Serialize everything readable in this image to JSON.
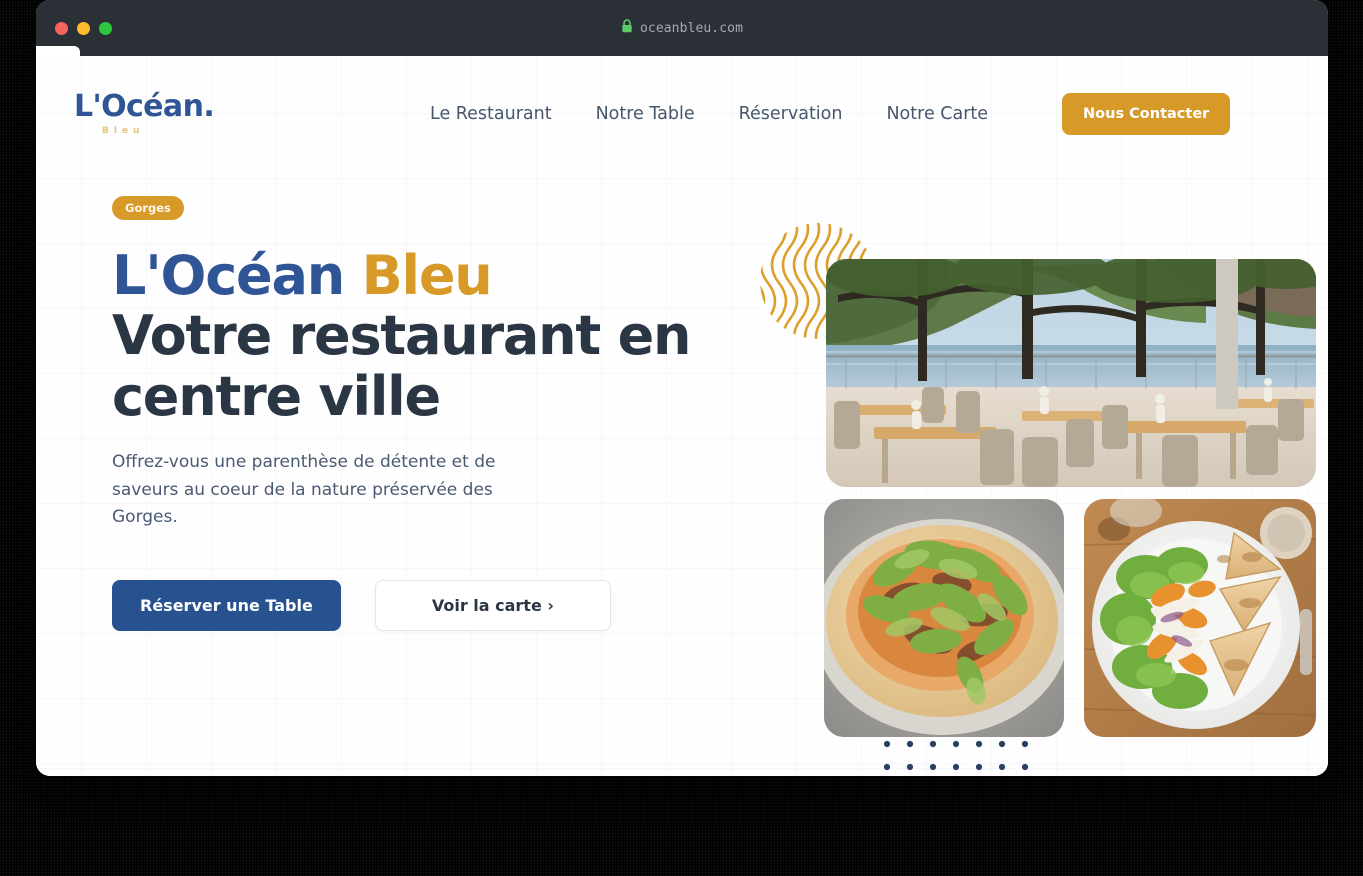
{
  "browser": {
    "traffic_lights": [
      "close-red",
      "minimize-yellow",
      "maximize-green"
    ],
    "lock_icon": "padlock-icon",
    "url": "oceanbleu.com"
  },
  "header": {
    "logo": {
      "main": "L'Océan",
      "dot": ".",
      "sub": "Bleu"
    },
    "nav": [
      {
        "label": "Le Restaurant"
      },
      {
        "label": "Notre Table"
      },
      {
        "label": "Réservation"
      },
      {
        "label": "Notre Carte"
      }
    ],
    "contact_button": "Nous Contacter"
  },
  "hero": {
    "badge": "Gorges",
    "title_line1_blue": "L'Océan ",
    "title_line1_gold": "Bleu",
    "title_line2": "Votre restaurant en",
    "title_line3": "centre ville",
    "subtitle": "Offrez-vous une parenthèse de détente et de saveurs au coeur de la nature préservée des Gorges.",
    "primary_button": "Réserver une Table",
    "secondary_button": "Voir la carte ›",
    "decorations": {
      "waves": "wavy-lines-circle-decoration",
      "dots": "dot-grid-decoration",
      "dot_columns": 7,
      "dot_rows": 3
    },
    "images": [
      {
        "name": "restaurant-terrace-lake-view",
        "alt": "Terrasse du restaurant avec vue sur le lac"
      },
      {
        "name": "pizza-roquette",
        "alt": "Pizza garnie de roquette"
      },
      {
        "name": "quesadilla-salade",
        "alt": "Quesadillas et salade"
      }
    ]
  },
  "colors": {
    "brand_blue": "#2f5596",
    "brand_gold": "#d79a29",
    "heading_dark": "#2b3645",
    "body_text": "#4a5a72",
    "button_blue": "#27528f",
    "titlebar": "#2b2f36"
  }
}
